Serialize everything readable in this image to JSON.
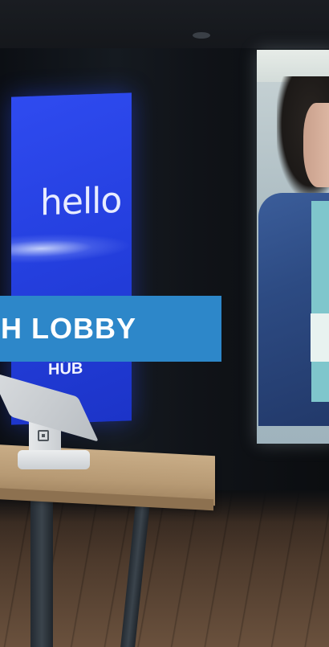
{
  "scene": {
    "banner": {
      "text": "H LOBBY",
      "color": "#2d87c9"
    },
    "blue_screen": {
      "greeting": "hello",
      "logo": "HÜB",
      "color": "#2540e0"
    },
    "pos_stand": {
      "icon": "square-logo-icon"
    }
  }
}
